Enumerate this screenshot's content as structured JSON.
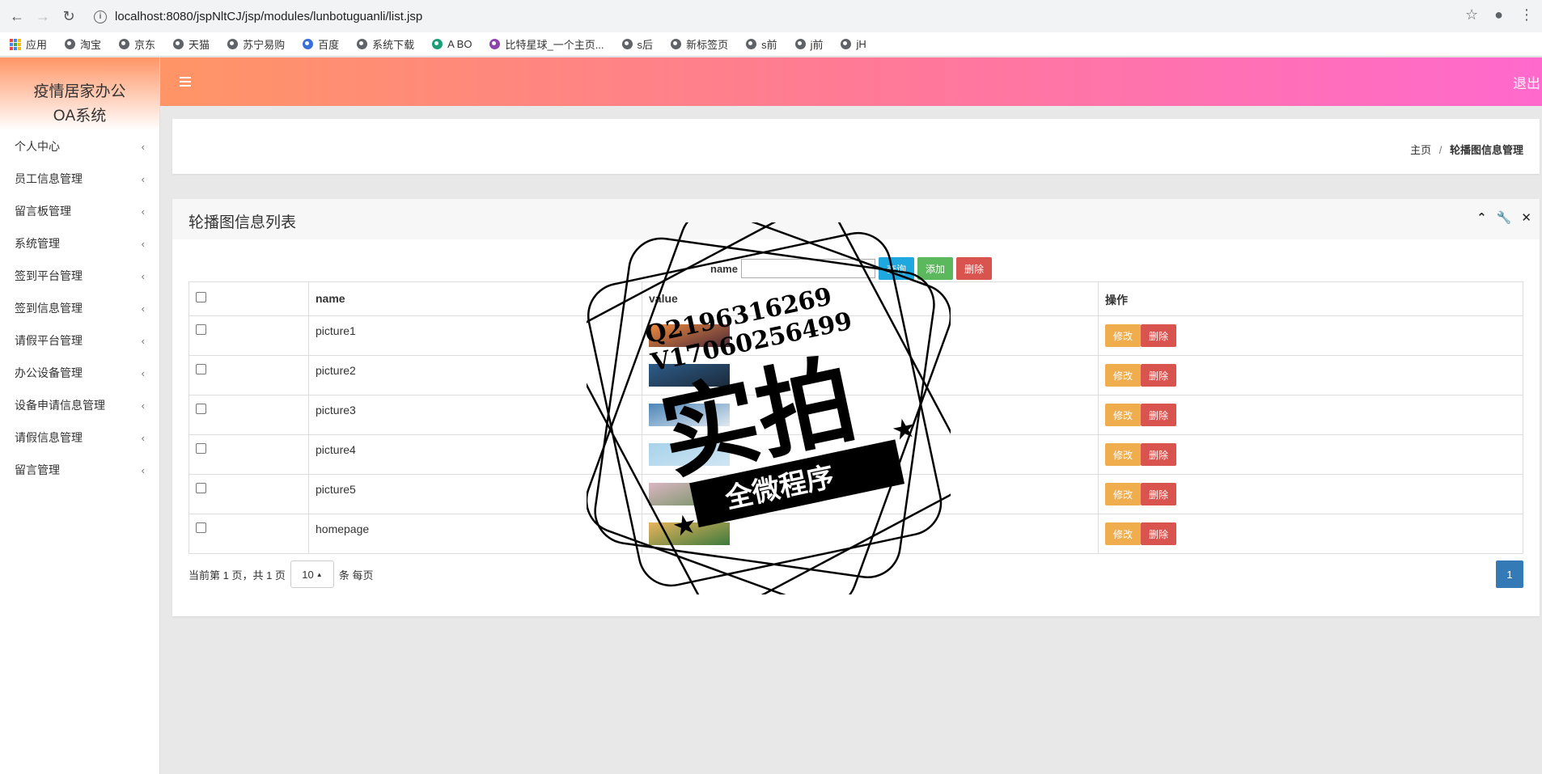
{
  "browser": {
    "url": "localhost:8080/jspNltCJ/jsp/modules/lunbotuguanli/list.jsp",
    "bookmarks": [
      "应用",
      "淘宝",
      "京东",
      "天猫",
      "苏宁易购",
      "百度",
      "系统下载",
      "A BO",
      "比特星球_一个主页...",
      "s后",
      "新标签页",
      "s前",
      "j前",
      "jH"
    ]
  },
  "sidebar": {
    "brand": "疫情居家办公OA系统",
    "items": [
      "个人中心",
      "员工信息管理",
      "留言板管理",
      "系统管理",
      "签到平台管理",
      "签到信息管理",
      "请假平台管理",
      "办公设备管理",
      "设备申请信息管理",
      "请假信息管理",
      "留言管理"
    ]
  },
  "topbar": {
    "logout": "退出"
  },
  "breadcrumb": {
    "home": "主页",
    "sep": "/",
    "current": "轮播图信息管理"
  },
  "panel": {
    "title": "轮播图信息列表",
    "search_label": "name",
    "search_value": "",
    "btn_query": "查询",
    "btn_add": "添加",
    "btn_delete": "删除"
  },
  "table": {
    "headers": [
      "name",
      "value",
      "操作"
    ],
    "rows": [
      {
        "name": "picture1",
        "edit": "修改",
        "del": "删除",
        "thumb_colors": [
          "#f08a3c",
          "#4a2a3a"
        ]
      },
      {
        "name": "picture2",
        "edit": "修改",
        "del": "删除",
        "thumb_colors": [
          "#2e5c8a",
          "#1b2a3a"
        ]
      },
      {
        "name": "picture3",
        "edit": "修改",
        "del": "删除",
        "thumb_colors": [
          "#4d86b8",
          "#e0e8f0"
        ]
      },
      {
        "name": "picture4",
        "edit": "修改",
        "del": "删除",
        "thumb_colors": [
          "#a8d2ea",
          "#cfe6f3"
        ]
      },
      {
        "name": "picture5",
        "edit": "修改",
        "del": "删除",
        "thumb_colors": [
          "#d9b6c2",
          "#6b8f5a"
        ]
      },
      {
        "name": "homepage",
        "edit": "修改",
        "del": "删除",
        "thumb_colors": [
          "#e8b45c",
          "#3d7a3d"
        ]
      }
    ]
  },
  "pagination": {
    "info": "当前第 1 页，共 1 页",
    "page_size": "10",
    "per_page": "条 每页",
    "current_page": "1"
  },
  "watermark": {
    "line1": "Q2196316269",
    "line2": "V17060256499",
    "main": "实拍",
    "ribbon": "全微程序"
  }
}
